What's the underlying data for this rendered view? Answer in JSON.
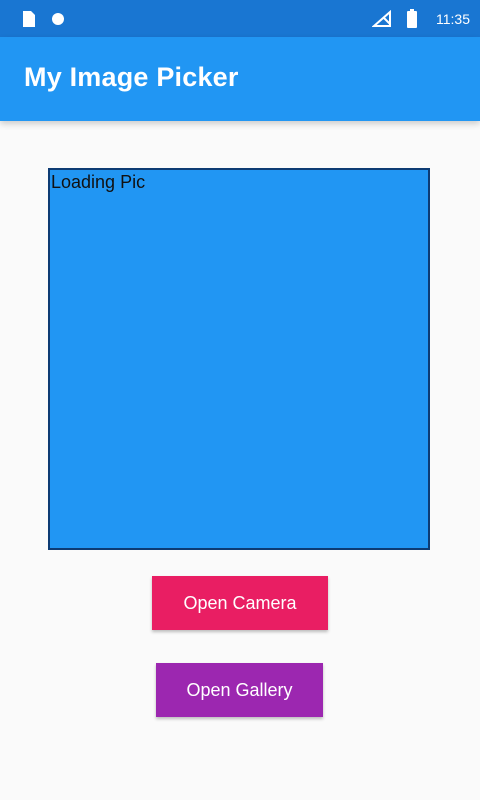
{
  "status_bar": {
    "left_icons": [
      "sim-card-icon",
      "circle-notification-icon"
    ],
    "right_icons": [
      "no-signal-icon",
      "battery-icon"
    ],
    "time": "11:35",
    "color": "#1976d2"
  },
  "app_bar": {
    "title": "My Image Picker",
    "color": "#2196f3"
  },
  "image_area": {
    "placeholder_text": "Loading Pic",
    "background": "#2196f3",
    "border_color": "#0d3b73"
  },
  "buttons": {
    "camera_label": "Open Camera",
    "camera_color": "#e91e63",
    "gallery_label": "Open Gallery",
    "gallery_color": "#9c27b0"
  }
}
